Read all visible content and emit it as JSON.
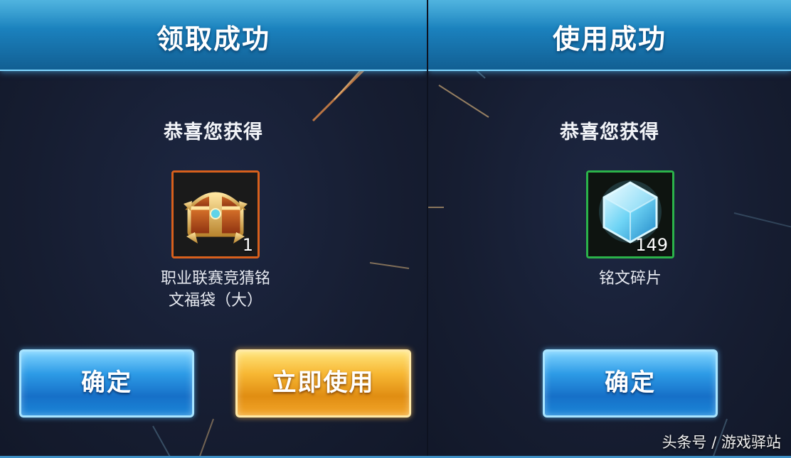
{
  "left_dialog": {
    "title": "领取成功",
    "congrats": "恭喜您获得",
    "item": {
      "icon": "treasure-chest-icon",
      "count": "1",
      "name_line1": "职业联赛竞猜铭",
      "name_line2": "文福袋（大）",
      "frame_color": "#d8601c"
    },
    "confirm_label": "确定",
    "use_label": "立即使用"
  },
  "right_dialog": {
    "title": "使用成功",
    "congrats": "恭喜您获得",
    "item": {
      "icon": "blue-crystal-icon",
      "count": "149",
      "name": "铭文碎片",
      "frame_color": "#2bb34a"
    },
    "confirm_label": "确定"
  },
  "watermark": "头条号 / 游戏驿站",
  "colors": {
    "header_blue": "#1a7fbb",
    "button_blue": "#2d9be6",
    "button_gold": "#f7b733",
    "background": "#161d31"
  }
}
